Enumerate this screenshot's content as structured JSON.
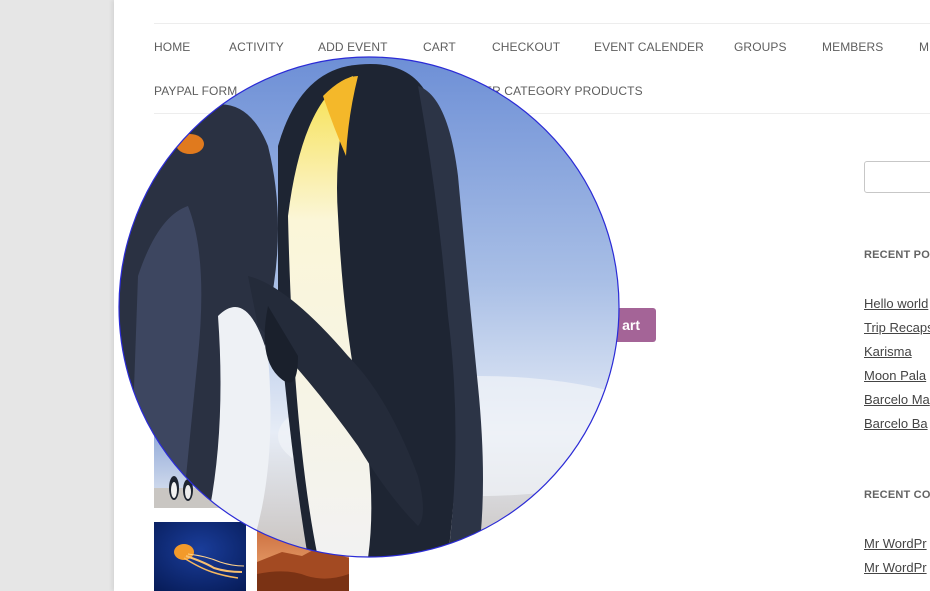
{
  "nav": {
    "row1": [
      "HOME",
      "ACTIVITY",
      "ADD EVENT",
      "CART",
      "CHECKOUT",
      "EVENT CALENDER",
      "GROUPS",
      "MEMBERS",
      "M"
    ],
    "row2": [
      "PAYPAL FORM",
      "ER CATEGORY PRODUCTS"
    ]
  },
  "product": {
    "add_to_cart_label": "art"
  },
  "sidebar": {
    "search_placeholder": "",
    "recent_posts_title": "RECENT POS",
    "recent_posts": [
      "Hello world",
      "Trip Recaps",
      "Karisma",
      "Moon Pala",
      "Barcelo Ma",
      "Barcelo Ba"
    ],
    "recent_comments_title": "RECENT COM",
    "recent_comments": [
      "Mr WordPr",
      "Mr WordPr"
    ]
  },
  "colors": {
    "accent": "#a46497",
    "lens_border": "#2b2bd6"
  },
  "icons": {
    "zoom": "magnifier-lens"
  }
}
